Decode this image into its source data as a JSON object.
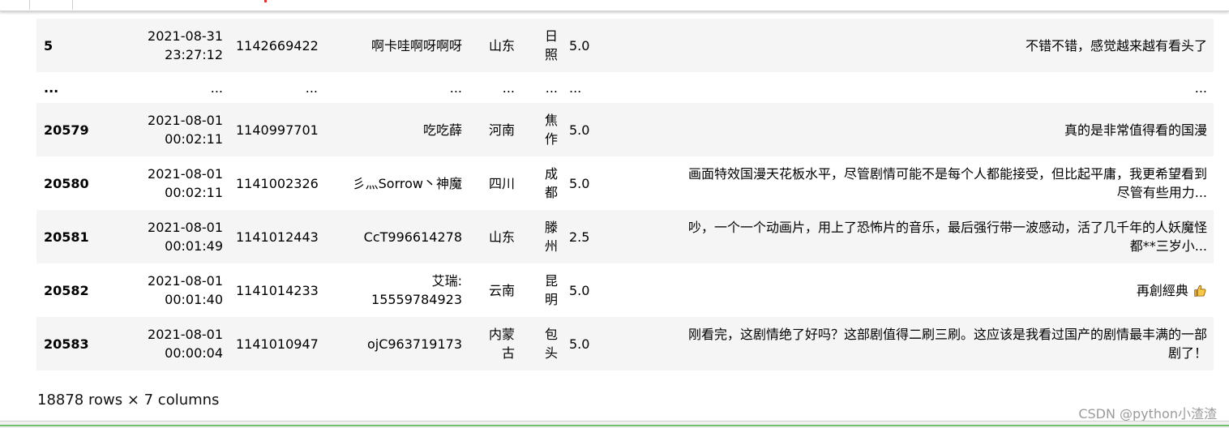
{
  "rows": [
    {
      "idx": "5",
      "time": [
        "2021-08-31",
        "23:27:12"
      ],
      "user_id": [
        "1142669422"
      ],
      "name": [
        "啊卡哇啊呀啊呀"
      ],
      "province": [
        "山东"
      ],
      "city": [
        "日",
        "照"
      ],
      "score": "5.0",
      "comment": [
        "不错不错，感觉越来越有看头了"
      ],
      "stripe": true,
      "height": 66
    },
    {
      "idx": "...",
      "time": [
        "..."
      ],
      "user_id": [
        "..."
      ],
      "name": [
        "..."
      ],
      "province": [
        "..."
      ],
      "city": [
        "..."
      ],
      "score": "...",
      "comment": [
        "..."
      ],
      "stripe": false,
      "height": 38
    },
    {
      "idx": "20579",
      "time": [
        "2021-08-01",
        "00:02:11"
      ],
      "user_id": [
        "1140997701"
      ],
      "name": [
        "吃吃薛"
      ],
      "province": [
        "河南"
      ],
      "city": [
        "焦",
        "作"
      ],
      "score": "5.0",
      "comment": [
        "真的是非常值得看的国漫"
      ],
      "stripe": true,
      "height": 66
    },
    {
      "idx": "20580",
      "time": [
        "2021-08-01",
        "00:02:11"
      ],
      "user_id": [
        "1141002326"
      ],
      "name": [
        "彡灬Sorrow丶神魔"
      ],
      "province": [
        "四川"
      ],
      "city": [
        "成",
        "都"
      ],
      "score": "5.0",
      "comment": [
        "画面特效国漫天花板水平，尽管剧情可能不是每个人都能接受，但比起平庸，我更希望看到",
        "尽管有些用力..."
      ],
      "stripe": false,
      "height": 66
    },
    {
      "idx": "20581",
      "time": [
        "2021-08-01",
        "00:01:49"
      ],
      "user_id": [
        "1141012443"
      ],
      "name": [
        "CcT996614278"
      ],
      "province": [
        "山东"
      ],
      "city": [
        "滕",
        "州"
      ],
      "score": "2.5",
      "comment": [
        "吵，一个一个动画片，用上了恐怖片的音乐，最后强行带一波感动，活了几千年的人妖魔怪",
        "都**三岁小..."
      ],
      "stripe": true,
      "height": 66
    },
    {
      "idx": "20582",
      "time": [
        "2021-08-01",
        "00:01:40"
      ],
      "user_id": [
        "1141014233"
      ],
      "name": [
        "艾瑞:",
        "15559784923"
      ],
      "province": [
        "云南"
      ],
      "city": [
        "昆",
        "明"
      ],
      "score": "5.0",
      "comment": [
        "再創經典"
      ],
      "comment_icon": "thumbs-up-icon",
      "stripe": false,
      "height": 66
    },
    {
      "idx": "20583",
      "time": [
        "2021-08-01",
        "00:00:04"
      ],
      "user_id": [
        "1141010947"
      ],
      "name": [
        "ojC963719173"
      ],
      "province": [
        "内蒙",
        "古"
      ],
      "city": [
        "包",
        "头"
      ],
      "score": "5.0",
      "comment": [
        "刚看完，这剧情绝了好吗？这部剧值得二刷三刷。这应该是我看过国产的剧情最丰满的一部",
        "剧了！"
      ],
      "stripe": true,
      "height": 66
    }
  ],
  "footer": {
    "summary": "18878 rows × 7 columns"
  },
  "watermark": "CSDN @python小渣渣",
  "colors": {
    "stripe": "#f5f5f5",
    "text": "#000000",
    "watermark": "#9a9a9a"
  }
}
